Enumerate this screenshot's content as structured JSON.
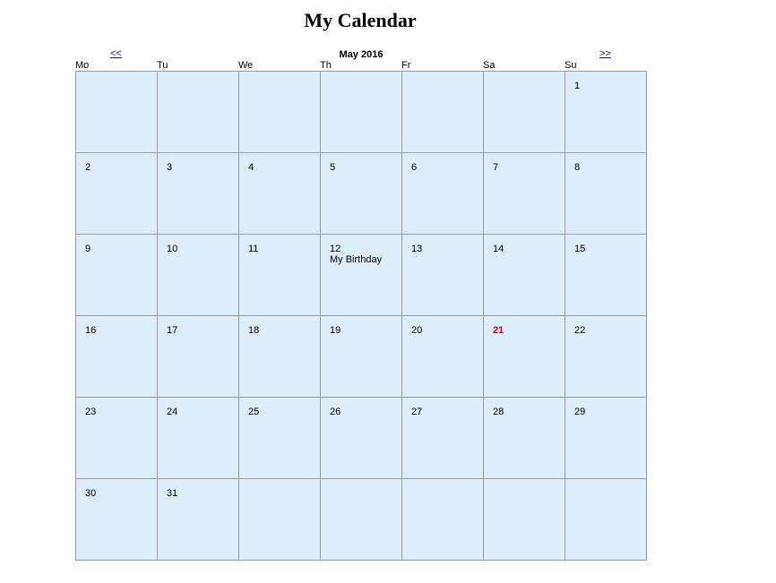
{
  "page": {
    "title": "My Calendar"
  },
  "calendar": {
    "month_label": "May 2016",
    "prev_label": "<<",
    "next_label": ">>",
    "today": "21",
    "weekdays": [
      "Mo",
      "Tu",
      "We",
      "Th",
      "Fr",
      "Sa",
      "Su"
    ],
    "weeks": [
      [
        "",
        "",
        "",
        "",
        "",
        "",
        "1"
      ],
      [
        "2",
        "3",
        "4",
        "5",
        "6",
        "7",
        "8"
      ],
      [
        "9",
        "10",
        "11",
        "12",
        "13",
        "14",
        "15"
      ],
      [
        "16",
        "17",
        "18",
        "19",
        "20",
        "21",
        "22"
      ],
      [
        "23",
        "24",
        "25",
        "26",
        "27",
        "28",
        "29"
      ],
      [
        "30",
        "31",
        "",
        "",
        "",
        "",
        ""
      ]
    ],
    "events": [
      {
        "day": "12",
        "text": "My Birthday"
      }
    ],
    "colors": {
      "cell_background": "#dcedfc",
      "border": "#9a9a9a",
      "today": "#d40000",
      "link": "#1a0dab"
    }
  }
}
